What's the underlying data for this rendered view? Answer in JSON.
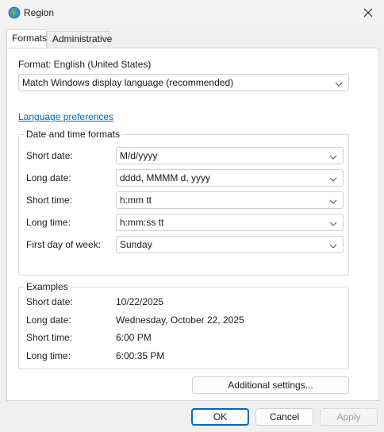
{
  "window": {
    "title": "Region",
    "icon": "globe-icon"
  },
  "tabs": [
    {
      "label": "Formats",
      "active": true
    },
    {
      "label": "Administrative",
      "active": false
    }
  ],
  "format": {
    "label": "Format: English (United States)",
    "value": "Match Windows display language (recommended)"
  },
  "language_link": "Language preferences",
  "datetime": {
    "title": "Date and time formats",
    "rows": [
      {
        "label": "Short date:",
        "value": "M/d/yyyy"
      },
      {
        "label": "Long date:",
        "value": "dddd, MMMM d, yyyy"
      },
      {
        "label": "Short time:",
        "value": "h:mm tt"
      },
      {
        "label": "Long time:",
        "value": "h:mm:ss tt"
      },
      {
        "label": "First day of week:",
        "value": "Sunday"
      }
    ]
  },
  "examples": {
    "title": "Examples",
    "rows": [
      {
        "label": "Short date:",
        "value": "10/22/2025"
      },
      {
        "label": "Long date:",
        "value": "Wednesday, October 22, 2025"
      },
      {
        "label": "Short time:",
        "value": "6:00 PM"
      },
      {
        "label": "Long time:",
        "value": "6:00:35 PM"
      }
    ]
  },
  "buttons": {
    "additional_settings": "Additional settings...",
    "ok": "OK",
    "cancel": "Cancel",
    "apply": "Apply"
  },
  "colors": {
    "accent": "#0067c0",
    "link": "#0067c0"
  }
}
